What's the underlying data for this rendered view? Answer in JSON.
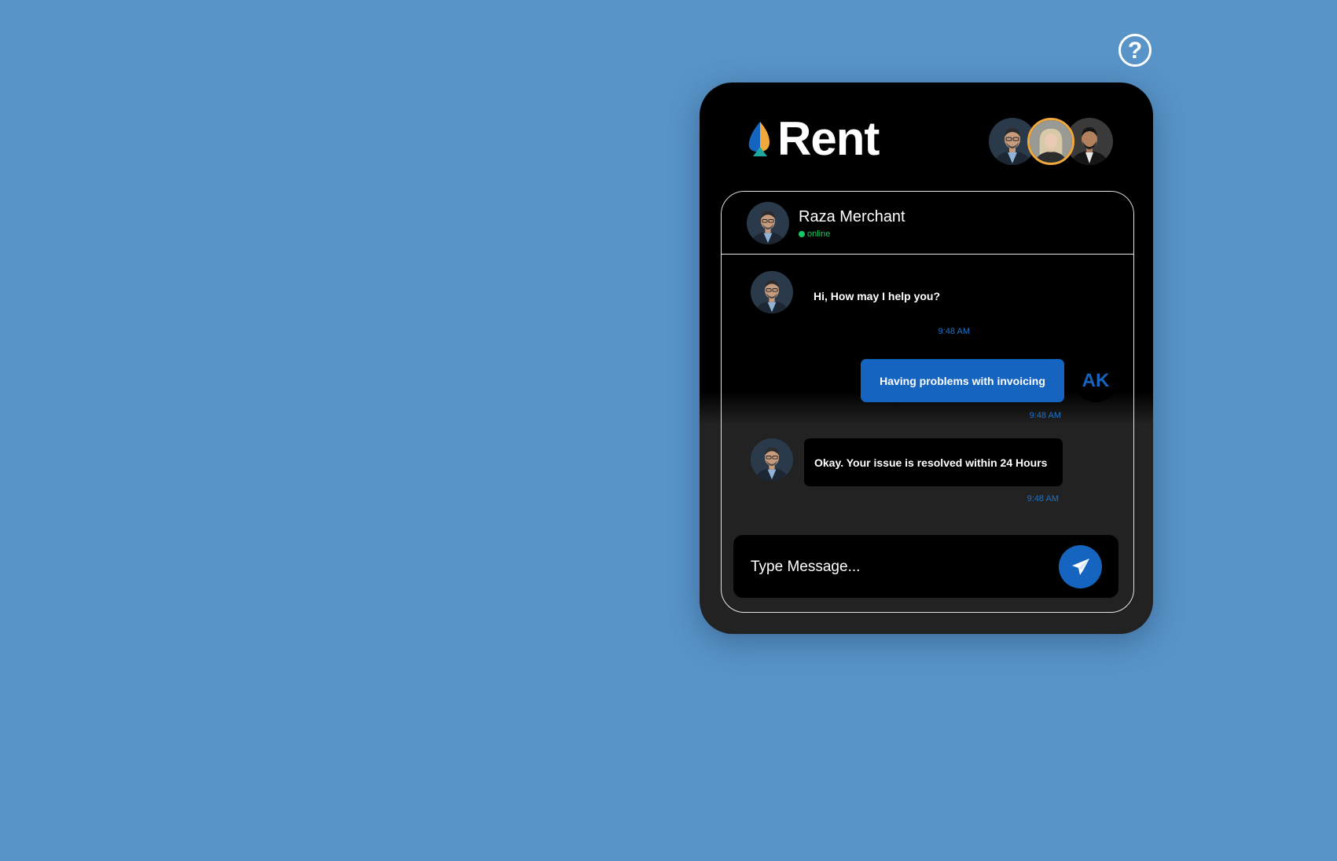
{
  "help": {
    "icon": "question-circle-icon",
    "glyph": "?"
  },
  "brand": {
    "name": "Rent",
    "logo_icon": "spade-drop-logo-icon",
    "colors": [
      "#f2a93b",
      "#1565c0",
      "#1ea7a0"
    ]
  },
  "agents": [
    {
      "icon": "agent-avatar-photo",
      "selected": false
    },
    {
      "icon": "agent-avatar-photo",
      "selected": true
    },
    {
      "icon": "agent-avatar-photo",
      "selected": false
    }
  ],
  "chat": {
    "contact_name": "Raza Merchant",
    "status": "online",
    "messages": [
      {
        "from": "agent",
        "text": "Hi, How may I help you?",
        "time": "9:48 AM"
      },
      {
        "from": "user",
        "initials": "AK",
        "text": "Having problems with invoicing",
        "time": "9:48 AM"
      },
      {
        "from": "agent",
        "text": "Okay. Your issue is resolved within 24 Hours",
        "time": "9:48 AM"
      }
    ],
    "input_placeholder": "Type Message...",
    "send_icon": "paper-plane-icon"
  },
  "colors": {
    "background": "#5894c8",
    "accent": "#1565c0",
    "online": "#17c964",
    "highlight": "#f2a93b"
  }
}
